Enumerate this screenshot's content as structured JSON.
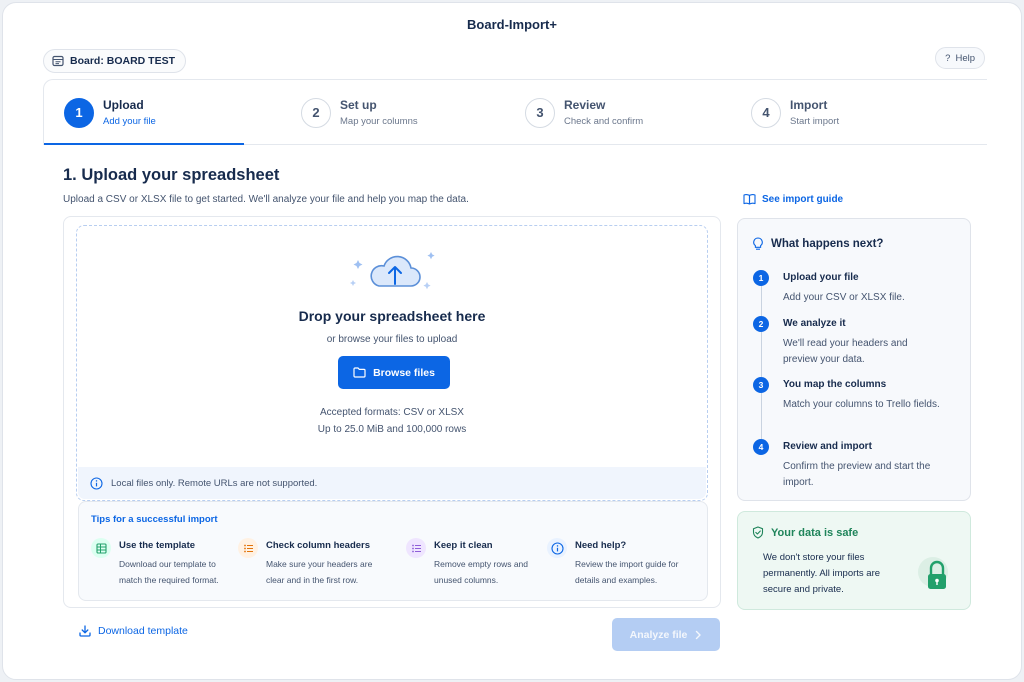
{
  "app": {
    "title": "Board-Import+"
  },
  "board": {
    "label": "Board: BOARD TEST"
  },
  "help": {
    "label": "Help",
    "glyph": "?"
  },
  "steps": [
    {
      "num": "1",
      "title": "Upload",
      "sub": "Add your file"
    },
    {
      "num": "2",
      "title": "Set up",
      "sub": "Map your columns"
    },
    {
      "num": "3",
      "title": "Review",
      "sub": "Check and confirm"
    },
    {
      "num": "4",
      "title": "Import",
      "sub": "Start import"
    }
  ],
  "main": {
    "heading": "1. Upload your spreadsheet",
    "lead": "Upload a CSV or XLSX file to get started. We'll analyze your file and help you map the data."
  },
  "dropzone": {
    "title": "Drop your spreadsheet here",
    "subtitle": "or browse your files to upload",
    "browse_label": "Browse files",
    "accepted_line1": "Accepted formats: CSV or XLSX",
    "accepted_line2": "Up to 25.0 MiB and 100,000 rows",
    "local_note": "Local files only. Remote URLs are not supported."
  },
  "tips": {
    "title": "Tips for a successful import",
    "items": [
      {
        "title": "Use the template",
        "text": "Download our template to match the required format.",
        "icon": "table-icon",
        "color": "#22a06b"
      },
      {
        "title": "Check column headers",
        "text": "Make sure your headers are clear and in the first row.",
        "icon": "list-icon",
        "color": "#e2740b"
      },
      {
        "title": "Keep it clean",
        "text": "Remove empty rows and unused columns.",
        "icon": "checklist-icon",
        "color": "#8f5ed8"
      },
      {
        "title": "Need help?",
        "text": "Review the import guide for details and examples.",
        "icon": "info-icon",
        "color": "#0c66e4"
      }
    ]
  },
  "footer": {
    "download_label": "Download template",
    "analyze_label": "Analyze file"
  },
  "sidebar": {
    "guide_label": "See import guide",
    "next_title": "What happens next?",
    "next_steps": [
      {
        "num": "1",
        "title": "Upload your file",
        "text": "Add your CSV or XLSX file."
      },
      {
        "num": "2",
        "title": "We analyze it",
        "text": "We'll read your headers and preview your data."
      },
      {
        "num": "3",
        "title": "You map the columns",
        "text": "Match your columns to Trello fields."
      },
      {
        "num": "4",
        "title": "Review and import",
        "text": "Confirm the preview and start the import."
      }
    ],
    "safe_title": "Your data is safe",
    "safe_text": "We don't store your files permanently. All imports are secure and private."
  },
  "colors": {
    "accent": "#0c66e4",
    "success": "#1f845a",
    "disabled": "#b4cdf3"
  }
}
